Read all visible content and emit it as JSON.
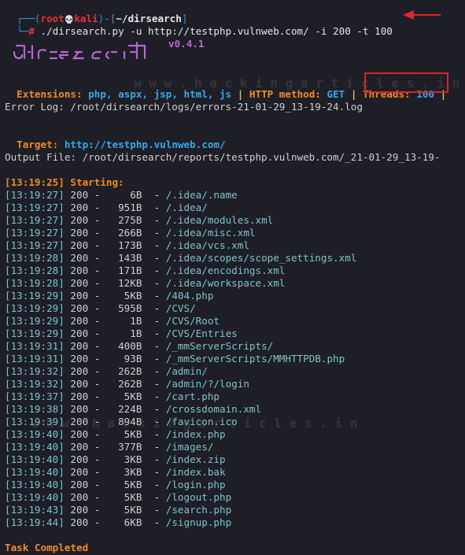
{
  "prompt": {
    "corner_top": "┌──(",
    "user": "root",
    "skull": "💀",
    "host": "kali",
    "mid": ")-[",
    "cwd": "~/dirsearch",
    "end": "]",
    "corner_bottom": "└─",
    "hash": "#",
    "command": " ./dirsearch.py -u http://testphp.vulnweb.com/ -i 200 -t 100"
  },
  "version": "v0.4.1",
  "config": {
    "ext_label": "Extensions: ",
    "ext_value": "php, aspx, jsp, html, js",
    "sep": " | ",
    "method_label": "HTTP method: ",
    "method_value": "GET",
    "threads_label": "Threads: ",
    "threads_value": "100",
    "tail": " | "
  },
  "error_log": "Error Log: /root/dirsearch/logs/errors-21-01-29_13-19-24.log",
  "target_label": "Target: ",
  "target_value": "http://testphp.vulnweb.com/",
  "output_file": "Output File: /root/dirsearch/reports/testphp.vulnweb.com/_21-01-29_13-19-",
  "starting": "[13:19:25] Starting:",
  "results": [
    {
      "time": "[13:19:27]",
      "code": "200",
      "size": "   6B",
      "path": "/.idea/.name"
    },
    {
      "time": "[13:19:27]",
      "code": "200",
      "size": " 951B",
      "path": "/.idea/"
    },
    {
      "time": "[13:19:27]",
      "code": "200",
      "size": " 275B",
      "path": "/.idea/modules.xml"
    },
    {
      "time": "[13:19:27]",
      "code": "200",
      "size": " 266B",
      "path": "/.idea/misc.xml"
    },
    {
      "time": "[13:19:27]",
      "code": "200",
      "size": " 173B",
      "path": "/.idea/vcs.xml"
    },
    {
      "time": "[13:19:28]",
      "code": "200",
      "size": " 143B",
      "path": "/.idea/scopes/scope_settings.xml"
    },
    {
      "time": "[13:19:28]",
      "code": "200",
      "size": " 171B",
      "path": "/.idea/encodings.xml"
    },
    {
      "time": "[13:19:28]",
      "code": "200",
      "size": "  12KB",
      "path": "/.idea/workspace.xml"
    },
    {
      "time": "[13:19:29]",
      "code": "200",
      "size": "   5KB",
      "path": "/404.php"
    },
    {
      "time": "[13:19:29]",
      "code": "200",
      "size": " 595B",
      "path": "/CVS/"
    },
    {
      "time": "[13:19:29]",
      "code": "200",
      "size": "   1B",
      "path": "/CVS/Root"
    },
    {
      "time": "[13:19:29]",
      "code": "200",
      "size": "   1B",
      "path": "/CVS/Entries"
    },
    {
      "time": "[13:19:31]",
      "code": "200",
      "size": " 400B",
      "path": "/_mmServerScripts/"
    },
    {
      "time": "[13:19:31]",
      "code": "200",
      "size": "  93B",
      "path": "/_mmServerScripts/MMHTTPDB.php"
    },
    {
      "time": "[13:19:32]",
      "code": "200",
      "size": " 262B",
      "path": "/admin/"
    },
    {
      "time": "[13:19:32]",
      "code": "200",
      "size": " 262B",
      "path": "/admin/?/login"
    },
    {
      "time": "[13:19:37]",
      "code": "200",
      "size": "   5KB",
      "path": "/cart.php"
    },
    {
      "time": "[13:19:38]",
      "code": "200",
      "size": " 224B",
      "path": "/crossdomain.xml"
    },
    {
      "time": "[13:19:39]",
      "code": "200",
      "size": " 894B",
      "path": "/favicon.ico"
    },
    {
      "time": "[13:19:40]",
      "code": "200",
      "size": "   5KB",
      "path": "/index.php"
    },
    {
      "time": "[13:19:40]",
      "code": "200",
      "size": " 377B",
      "path": "/images/"
    },
    {
      "time": "[13:19:40]",
      "code": "200",
      "size": "   3KB",
      "path": "/index.zip"
    },
    {
      "time": "[13:19:40]",
      "code": "200",
      "size": "   3KB",
      "path": "/index.bak"
    },
    {
      "time": "[13:19:40]",
      "code": "200",
      "size": "   5KB",
      "path": "/login.php"
    },
    {
      "time": "[13:19:40]",
      "code": "200",
      "size": "   5KB",
      "path": "/logout.php"
    },
    {
      "time": "[13:19:43]",
      "code": "200",
      "size": "   5KB",
      "path": "/search.php"
    },
    {
      "time": "[13:19:44]",
      "code": "200",
      "size": "   6KB",
      "path": "/signup.php"
    }
  ],
  "task_completed": "Task Completed",
  "colors": {
    "background": "#1e1e26",
    "prompt_blue": "#3b8ed8",
    "prompt_red": "#e8303a",
    "orange": "#f08a24",
    "cyan": "#34a8e8",
    "separator": "#f0c020",
    "logo_purple": "#b866d6",
    "result_teal": "#7ec3c7",
    "highlight_red": "#d8232a"
  }
}
